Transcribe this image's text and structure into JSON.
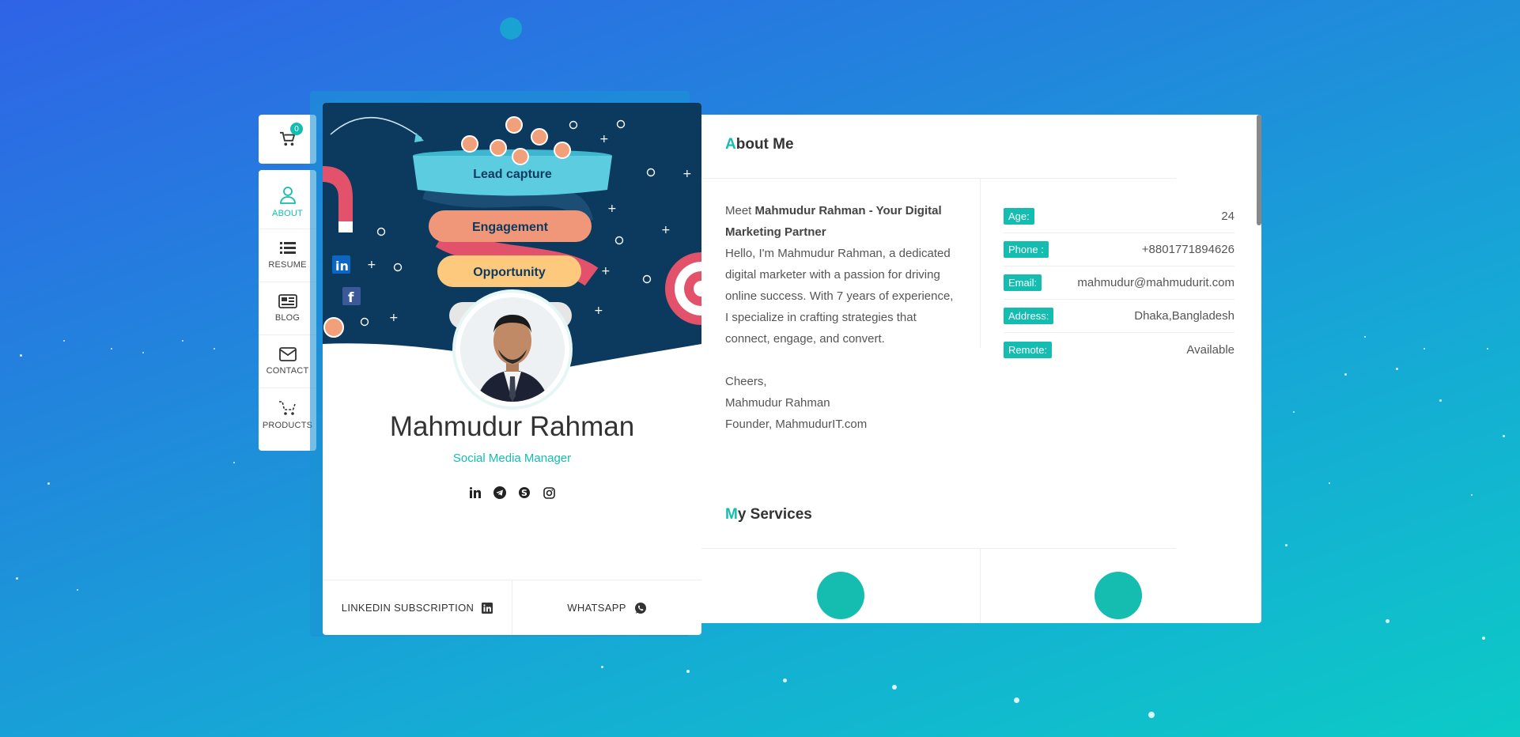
{
  "cart": {
    "count": "0"
  },
  "nav": [
    {
      "key": "about",
      "label": "ABOUT"
    },
    {
      "key": "resume",
      "label": "RESUME"
    },
    {
      "key": "blog",
      "label": "BLOG"
    },
    {
      "key": "contact",
      "label": "CONTACT"
    },
    {
      "key": "products",
      "label": "PRODUCTS"
    }
  ],
  "banner": {
    "funnel": [
      "Lead capture",
      "Engagement",
      "Opportunity"
    ]
  },
  "profile": {
    "name": "Mahmudur Rahman",
    "role": "Social Media Manager",
    "socials": [
      "linkedin-icon",
      "telegram-icon",
      "skype-icon",
      "instagram-icon"
    ]
  },
  "footer": {
    "linkedin_label": "LINKEDIN SUBSCRIPTION",
    "whatsapp_label": "WHATSAPP"
  },
  "about": {
    "title_first": "A",
    "title_rest": "bout Me",
    "intro": "Meet ",
    "intro_bold": "Mahmudur Rahman - Your Digital Marketing Partner",
    "body": "Hello, I'm Mahmudur Rahman, a dedicated digital marketer with a passion for driving online success. With 7 years of experience, I specialize in crafting strategies that connect, engage, and convert.",
    "signoff": "Cheers,",
    "sign_name": "Mahmudur Rahman",
    "sign_title": "Founder, MahmudurIT.com",
    "info": [
      {
        "key": "Age:",
        "value": "24"
      },
      {
        "key": "Phone :",
        "value": "+8801771894626"
      },
      {
        "key": "Email:",
        "value": "mahmudur@mahmudurit.com"
      },
      {
        "key": "Address:",
        "value": "Dhaka,Bangladesh"
      },
      {
        "key": "Remote:",
        "value": "Available"
      }
    ]
  },
  "services": {
    "title_first": "M",
    "title_rest": "y Services"
  },
  "colors": {
    "accent": "#14bdb0",
    "banner_bg": "#0c3a5f"
  }
}
